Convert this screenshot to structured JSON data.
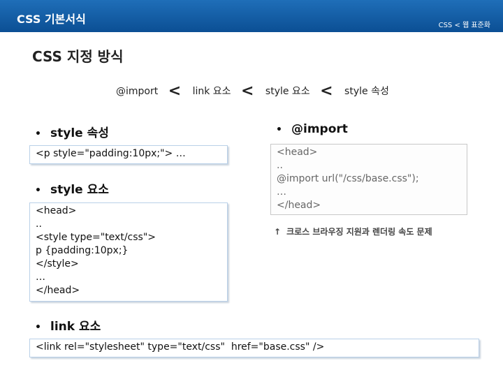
{
  "header": {
    "title": "CSS 기본서식",
    "subtitle": "CSS < 웹 표준화"
  },
  "section_title": "CSS 지정 방식",
  "priority": {
    "items": [
      "@import",
      "link 요소",
      "style 요소",
      "style 속성"
    ],
    "separator": "<"
  },
  "style_attr": {
    "bullet": "•",
    "heading": "style 속성",
    "code": "<p style=\"padding:10px;\"> …"
  },
  "style_element": {
    "bullet": "•",
    "heading": "style 요소",
    "code": "<head>\n..\n<style type=\"text/css\">\np {padding:10px;}\n</style>\n…\n</head>"
  },
  "link_element": {
    "bullet": "•",
    "heading": "link 요소",
    "code": "<link rel=\"stylesheet\" type=\"text/css\"  href=\"base.css\" />"
  },
  "import_rule": {
    "bullet": "•",
    "heading": "@import",
    "code": "<head>\n..\n@import url(\"/css/base.css\");\n…\n</head>"
  },
  "note": {
    "arrow": "↑",
    "text": "크로스 브라우징 지원과 렌더링 속도 문제"
  }
}
